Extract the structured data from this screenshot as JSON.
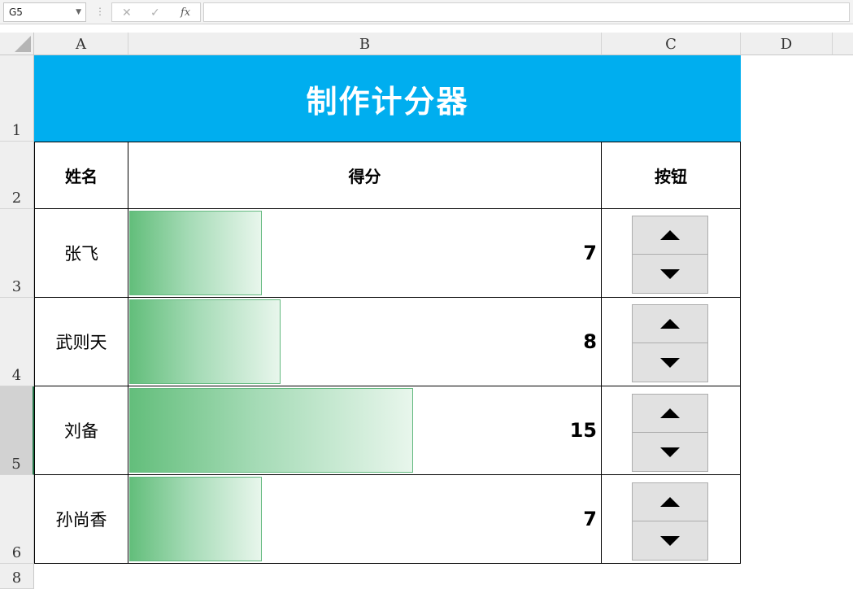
{
  "formula_bar": {
    "name_box": "G5",
    "cancel_icon": "✕",
    "enter_icon": "✓",
    "function_icon": "fx",
    "formula": ""
  },
  "columns": [
    "A",
    "B",
    "C",
    "D"
  ],
  "rows": [
    "1",
    "2",
    "3",
    "4",
    "5",
    "6",
    "8"
  ],
  "sheet": {
    "title": "制作计分器",
    "title_bg": "#00aeef",
    "headers": {
      "name": "姓名",
      "score": "得分",
      "button": "按钮"
    },
    "records": [
      {
        "name": "张飞",
        "score": "7",
        "score_fraction": 0.28
      },
      {
        "name": "武则天",
        "score": "8",
        "score_fraction": 0.32
      },
      {
        "name": "刘备",
        "score": "15",
        "score_fraction": 0.6
      },
      {
        "name": "孙尚香",
        "score": "7",
        "score_fraction": 0.28
      }
    ],
    "bar_color": "#63be7b",
    "selected_row": "5"
  }
}
